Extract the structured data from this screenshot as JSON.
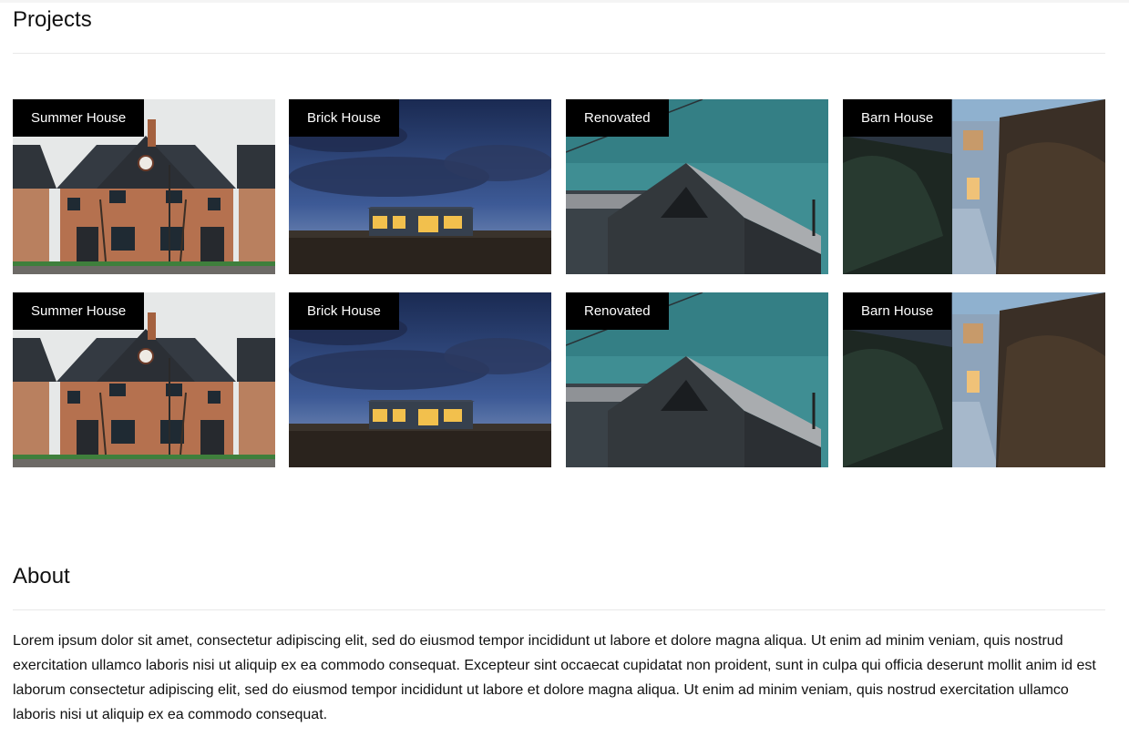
{
  "projects": {
    "title": "Projects",
    "items": [
      {
        "label": "Summer House",
        "icon": "house-photo"
      },
      {
        "label": "Brick House",
        "icon": "house-photo"
      },
      {
        "label": "Renovated",
        "icon": "house-photo"
      },
      {
        "label": "Barn House",
        "icon": "house-photo"
      },
      {
        "label": "Summer House",
        "icon": "house-photo"
      },
      {
        "label": "Brick House",
        "icon": "house-photo"
      },
      {
        "label": "Renovated",
        "icon": "house-photo"
      },
      {
        "label": "Barn House",
        "icon": "house-photo"
      }
    ]
  },
  "about": {
    "title": "About",
    "text": "Lorem ipsum dolor sit amet, consectetur adipiscing elit, sed do eiusmod tempor incididunt ut labore et dolore magna aliqua. Ut enim ad minim veniam, quis nostrud exercitation ullamco laboris nisi ut aliquip ex ea commodo consequat. Excepteur sint occaecat cupidatat non proident, sunt in culpa qui officia deserunt mollit anim id est laborum consectetur adipiscing elit, sed do eiusmod tempor incididunt ut labore et dolore magna aliqua. Ut enim ad minim veniam, quis nostrud exercitation ullamco laboris nisi ut aliquip ex ea commodo consequat."
  },
  "colors": {
    "tag_background": "#000000",
    "tag_text": "#ffffff",
    "divider": "#e9e9e9"
  }
}
